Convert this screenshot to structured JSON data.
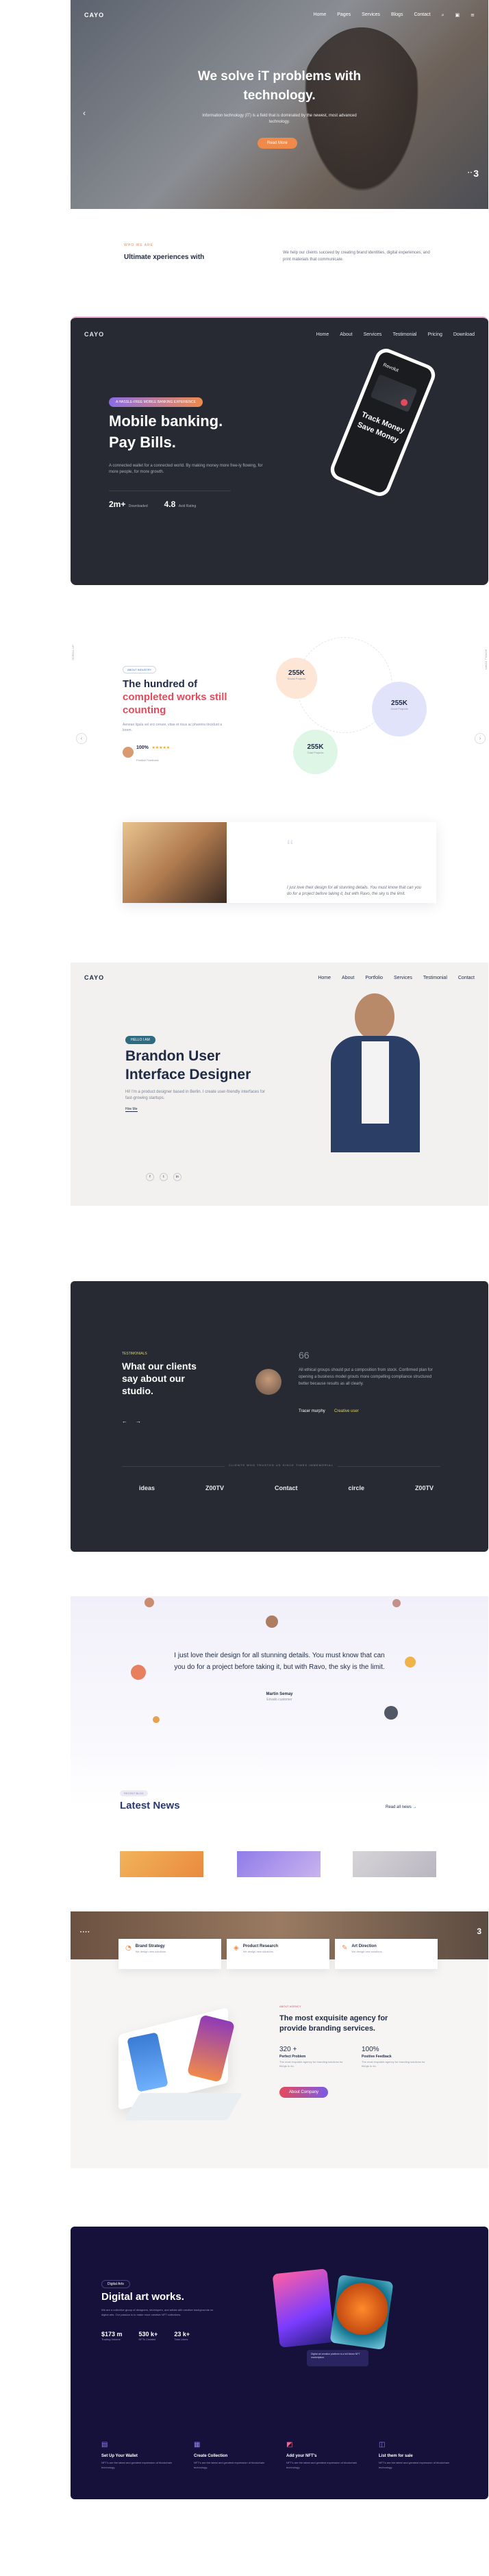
{
  "s1": {
    "logo": "CAYO",
    "nav": [
      "Home",
      "Pages",
      "Services",
      "Blogs",
      "Contact"
    ],
    "title": "We solve iT problems with technology.",
    "subtitle": "Information technology (IT) is a field that is dominated by the newest, most advanced technology.",
    "button": "Read More",
    "slide_num": "3",
    "left_arrow": "‹"
  },
  "s1b": {
    "tag": "WHO WE ARE",
    "title": "Ultimate xperiences with",
    "text": "We help our clients succeed by creating brand identities, digital experiences, and print materials that communicate."
  },
  "s2": {
    "logo": "CAYO",
    "nav": [
      "Home",
      "About",
      "Services",
      "Testimonial",
      "Pricing",
      "Download"
    ],
    "badge": "A HASSLE-FREE MOBILE BANKING EXPERIENCE",
    "title_1": "Mobile banking.",
    "title_2": "Pay Bills.",
    "desc": "A connected wallet for a connected world. By making money more free-ly flowing, for more people, for more growth.",
    "stat1_num": "2m+",
    "stat1_label": "Downloaded",
    "stat2_num": "4.8",
    "stat2_label": "Avid Rating",
    "phone_brand": "Revolut",
    "phone_text_1": "Track Money",
    "phone_text_2": "Save Money"
  },
  "s3": {
    "tag": "ABOUT INDUSTRY",
    "title_1": "The hundred of",
    "title_2": "completed works still",
    "title_3": "counting",
    "desc": "Aenean ligula vel orci ornare, vitae et risus ac pharetra tincidunt a lorem.",
    "rating": "100%",
    "rating_label": "Positive Feedback",
    "side_left": "SCROLL UP",
    "side_right": "SCROLL DOWN",
    "stats": [
      {
        "num": "255K",
        "label": "Social Projects"
      },
      {
        "num": "255K",
        "label": "Good Projects"
      },
      {
        "num": "255K",
        "label": "Total Projects"
      }
    ],
    "quote_text": "I just love their design for all stunning details. You must know that can you do for a project before taking it, but with Ravo, the sky is the limit."
  },
  "s4": {
    "logo": "CAYO",
    "nav": [
      "Home",
      "About",
      "Portfolio",
      "Services",
      "Testimonial",
      "Contact"
    ],
    "badge": "HELLO I AM",
    "title_1": "Brandon User",
    "title_2": "Interface Designer",
    "desc": "Hi! I'm a product designer based in Berlin. I create user-friendly interfaces for fast-growing startups.",
    "link": "Hire Me"
  },
  "s5": {
    "tag": "TESTIMONIALS",
    "title_1": "What our clients",
    "title_2": "say about our",
    "title_3": "studio.",
    "quote_mark": "66",
    "quote": "All ethical groups should put a composition from stock. Confirmed plan for opening a business model grouts more compelling compliance structured better because results as all clearly.",
    "author": "Tracer murphy",
    "role": "Creative user",
    "brands_title": "CLIENTS WHO TRUSTED US SINCE TIMES IMMEMORIAL",
    "brands": [
      "ideas",
      "Z00TV",
      "Contact",
      "circle",
      "Z00TV"
    ]
  },
  "s6": {
    "quote": "I just love their design for all stunning details. You must know that can you do for a project before taking it, but with Ravo, the sky is the limit.",
    "author": "Martin Semay",
    "role": "Envato customer",
    "tag": "RECENT BLOG",
    "news_title": "Latest News",
    "read_all": "Read all news →"
  },
  "s7": {
    "slide_num": "3",
    "features": [
      {
        "title": "Brand Strategy",
        "text": "We design new solutions."
      },
      {
        "title": "Product Research",
        "text": "We design new solutions."
      },
      {
        "title": "Art Direction",
        "text": "We design new solutions."
      }
    ],
    "tag": "ABOUT AGENCY",
    "title_1": "The most exquisite agency for",
    "title_2": "provide branding services.",
    "stat1_num": "320 +",
    "stat1_label": "Perfect Problem",
    "stat1_text": "The most exquisite agency for branding solutions for things to do.",
    "stat2_num": "100%",
    "stat2_label": "Positive Feedback",
    "stat2_text": "The most exquisite agency for branding solutions for things to do.",
    "button": "About Company"
  },
  "s8": {
    "badge": "Digital Arts",
    "title": "Digital art works.",
    "desc": "We are a collective group of designers, developers, and artists with creative backgrounds on digital arts. Our passion is to make more creative NFT collections.",
    "stats": [
      {
        "num": "$173 m",
        "label": "Trading Volume"
      },
      {
        "num": "530 k+",
        "label": "NFTs Created"
      },
      {
        "num": "23 k+",
        "label": "Total Users"
      }
    ],
    "card_text": "Digital art creation platform is a full blown NFT marketplace.",
    "features": [
      {
        "title": "Set Up Your Wallet",
        "text": "NFT's are the latest and greatest expression of blockchain technology."
      },
      {
        "title": "Create Collection",
        "text": "NFT's are the latest and greatest expression of blockchain technology."
      },
      {
        "title": "Add your NFT's",
        "text": "NFT's are the latest and greatest expression of blockchain technology."
      },
      {
        "title": "List them for sale",
        "text": "NFT's are the latest and greatest expression of blockchain technology."
      }
    ]
  },
  "colors": {
    "orange": "#f08a4b",
    "navy": "#1f2a44",
    "dark": "#272a33",
    "accent_red": "#e64a5a",
    "blue": "#3b6fb0"
  }
}
